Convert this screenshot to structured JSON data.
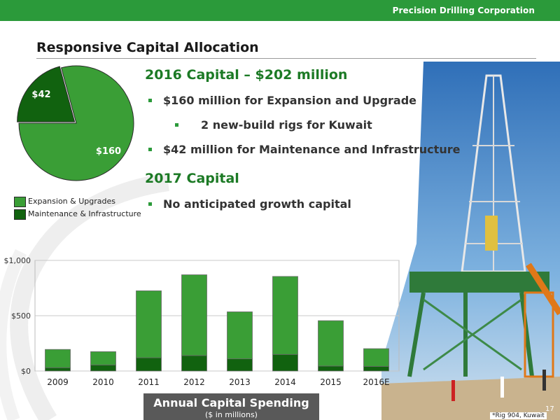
{
  "header": {
    "company": "Precision Drilling Corporation",
    "slide_title": "Responsive Capital Allocation",
    "bar_color": "#2b9a3a"
  },
  "content": {
    "capital_2016_heading": "2016 Capital – $202 million",
    "bullets_2016": [
      {
        "text": "$160 million for Expansion and Upgrade",
        "level": 1
      },
      {
        "text": "2 new-build rigs for Kuwait",
        "level": 2
      },
      {
        "text": "$42 million for Maintenance and Infrastructure",
        "level": 1
      }
    ],
    "capital_2017_heading": "2017 Capital",
    "bullets_2017": [
      {
        "text": "No anticipated growth capital",
        "level": 1
      }
    ]
  },
  "pie_legend": [
    {
      "label": "Expansion & Upgrades",
      "color": "#3a9e36"
    },
    {
      "label": "Maintenance & Infrastructure",
      "color": "#11620f"
    }
  ],
  "chart_title": "Annual Capital Spending",
  "chart_subtitle": "($ in millions)",
  "photo_caption": "*Rig 904, Kuwait",
  "page_number": "17",
  "chart_data": [
    {
      "type": "pie",
      "categories": [
        "Expansion & Upgrades",
        "Maintenance & Infrastructure"
      ],
      "values": [
        160,
        42
      ],
      "data_labels": [
        "$160",
        "$42"
      ],
      "colors": [
        "#3a9e36",
        "#11620f"
      ]
    },
    {
      "type": "bar",
      "stacked": true,
      "categories": [
        "2009",
        "2010",
        "2011",
        "2012",
        "2013",
        "2014",
        "2015",
        "2016E"
      ],
      "series": [
        {
          "name": "Maintenance & Infrastructure",
          "values": [
            30,
            55,
            120,
            140,
            110,
            150,
            45,
            42
          ],
          "color": "#11620f"
        },
        {
          "name": "Expansion & Upgrades",
          "values": [
            165,
            120,
            605,
            730,
            425,
            705,
            410,
            160
          ],
          "color": "#3a9e36"
        }
      ],
      "ylim": [
        0,
        1000
      ],
      "yticks": [
        0,
        500,
        1000
      ],
      "ytick_labels": [
        "$0",
        "$500",
        "$1,000"
      ],
      "title": "Annual Capital Spending",
      "subtitle": "($ in millions)",
      "grid": true
    }
  ]
}
